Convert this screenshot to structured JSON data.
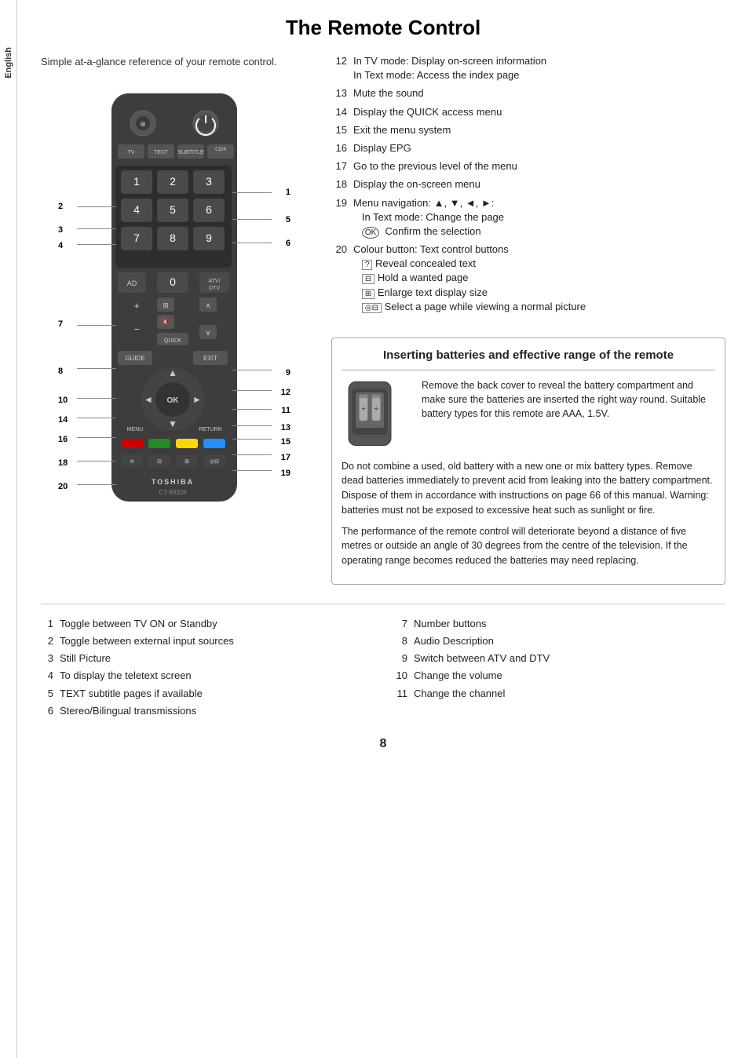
{
  "sidebar": {
    "label": "English"
  },
  "page": {
    "title": "The Remote Control",
    "intro": "Simple at-a-glance reference of your remote control.",
    "page_number": "8"
  },
  "right_list": [
    {
      "num": "12",
      "desc": "In TV mode: Display on-screen information\nIn Text mode: Access the index page"
    },
    {
      "num": "13",
      "desc": "Mute the sound"
    },
    {
      "num": "14",
      "desc": "Display the QUICK access menu"
    },
    {
      "num": "15",
      "desc": "Exit the menu system"
    },
    {
      "num": "16",
      "desc": "Display EPG"
    },
    {
      "num": "17",
      "desc": "Go to the previous level of the menu"
    },
    {
      "num": "18",
      "desc": "Display the on-screen menu"
    },
    {
      "num": "19",
      "desc": "Menu navigation: ▲, ▼, ◄, ►:\nIn Text mode: Change the page\n⊛  Confirm the selection"
    },
    {
      "num": "20",
      "desc": "Colour button: Text control buttons\n⊘  Reveal concealed text\n⊟  Hold a wanted page\n⊞  Enlarge text display size\n◎⊟  Select a page while viewing a normal picture"
    }
  ],
  "bottom_list": [
    {
      "num": "1",
      "desc": "Toggle between TV ON or Standby"
    },
    {
      "num": "2",
      "desc": "Toggle between external input sources"
    },
    {
      "num": "3",
      "desc": "Still Picture"
    },
    {
      "num": "4",
      "desc": "To display the teletext screen"
    },
    {
      "num": "5",
      "desc": "TEXT subtitle pages if available"
    },
    {
      "num": "6",
      "desc": "Stereo/Bilingual transmissions"
    },
    {
      "num": "7",
      "desc": "Number buttons"
    },
    {
      "num": "8",
      "desc": "Audio Description"
    },
    {
      "num": "9",
      "desc": "Switch between ATV and DTV"
    },
    {
      "num": "10",
      "desc": "Change the volume"
    },
    {
      "num": "11",
      "desc": "Change the channel"
    }
  ],
  "battery_section": {
    "title": "Inserting batteries and effective range of the remote",
    "image_alt": "battery compartment illustration",
    "description": "Remove the back cover to reveal the battery compartment and make sure the batteries are inserted the right way round. Suitable battery types for this remote are AAA, 1.5V.",
    "para1": "Do not combine a used, old battery with a new one or mix battery types. Remove dead batteries immediately to prevent acid from leaking into the battery compartment. Dispose of them in accordance with instructions on page 66 of this manual. Warning: batteries must not be exposed to excessive heat such as sunlight or fire.",
    "para2": "The performance of the remote control will deteriorate beyond a distance of five metres or outside an angle of 30 degrees from the centre of the television. If the operating range becomes reduced the batteries may need replacing."
  },
  "remote": {
    "brand": "TOSHIBA",
    "model": "CT-90326"
  }
}
